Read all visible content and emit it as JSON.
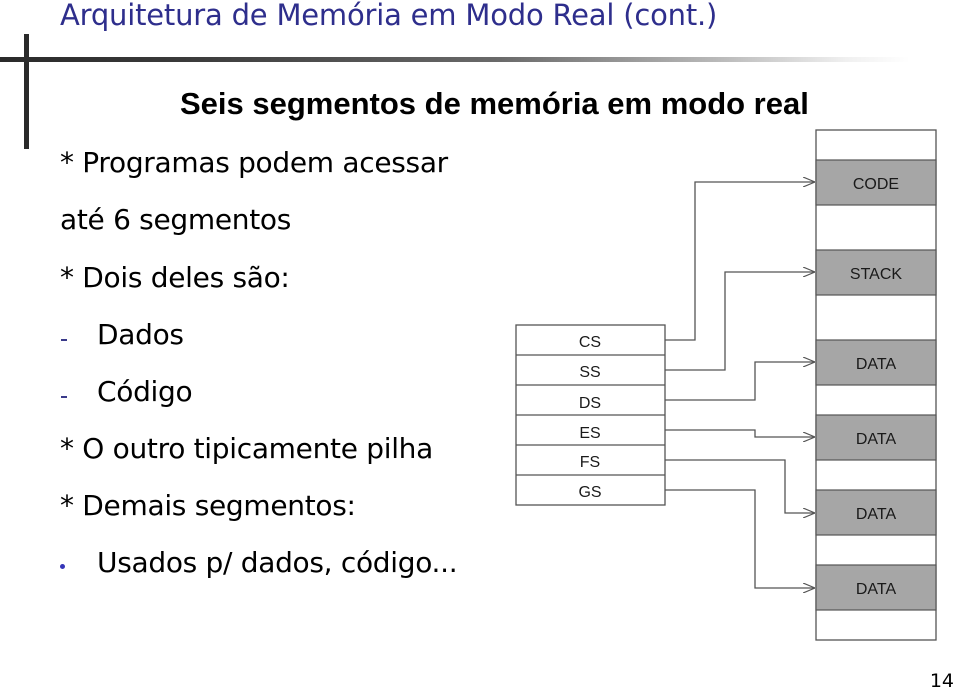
{
  "slide": {
    "title": "Arquitetura de Memória em Modo Real (cont.)",
    "subtitle": "Seis segmentos de memória em modo real",
    "page_number": "14",
    "colors": {
      "title": "#2e2e8c",
      "segment_fill": "#a6a6a6",
      "line": "#555555"
    }
  },
  "body": {
    "lines": [
      {
        "marker": "*",
        "text": "* Programas podem acessar"
      },
      {
        "marker": "",
        "text": "até 6 segmentos"
      },
      {
        "marker": "*",
        "text": "* Dois deles são:"
      },
      {
        "marker": "dash",
        "text": "Dados"
      },
      {
        "marker": "dash",
        "text": "Código"
      },
      {
        "marker": "*",
        "text": "* O outro tipicamente pilha"
      },
      {
        "marker": "*",
        "text": "* Demais segmentos:"
      },
      {
        "marker": "dot",
        "text": "Usados p/ dados, código..."
      }
    ]
  },
  "diagram": {
    "registers": [
      "CS",
      "SS",
      "DS",
      "ES",
      "FS",
      "GS"
    ],
    "segments": [
      "CODE",
      "STACK",
      "DATA",
      "DATA",
      "DATA",
      "DATA"
    ],
    "connections": [
      {
        "from": "CS",
        "to_segment_index": 0
      },
      {
        "from": "SS",
        "to_segment_index": 1
      },
      {
        "from": "DS",
        "to_segment_index": 2
      },
      {
        "from": "ES",
        "to_segment_index": 3
      },
      {
        "from": "FS",
        "to_segment_index": 4
      },
      {
        "from": "GS",
        "to_segment_index": 5
      }
    ]
  }
}
